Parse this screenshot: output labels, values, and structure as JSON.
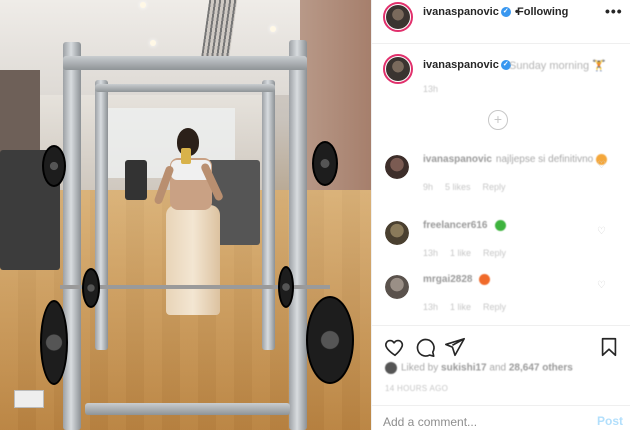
{
  "header": {
    "username": "ivanaspanovic",
    "separator": "•",
    "follow_status": "Following",
    "more_icon": "•••"
  },
  "caption": {
    "username": "ivanaspanovic",
    "text": "Sunday morning 🏋",
    "time": "13h",
    "load_more_icon": "+"
  },
  "comments": [
    {
      "username": "ivanaspanovic",
      "text": "najljepse si definitivno",
      "time": "9h",
      "likes": "5 likes",
      "reply": "Reply",
      "emoji_color": "#f4a73b"
    },
    {
      "username": "freelancer616",
      "text": "",
      "time": "13h",
      "likes": "1 like",
      "reply": "Reply",
      "emoji_color": "#3eb33e"
    },
    {
      "username": "mrgai2828",
      "text": "",
      "time": "13h",
      "likes": "1 like",
      "reply": "Reply",
      "emoji_color": "#f06a2a"
    }
  ],
  "actions": {
    "icons": [
      "heart-icon",
      "comment-icon",
      "share-icon",
      "bookmark-icon"
    ]
  },
  "likes": {
    "prefix": "Liked by",
    "first_user": "sukishi17",
    "middle": "and",
    "count": "28,647 others"
  },
  "time_ago": "14 HOURS AGO",
  "add_comment": {
    "placeholder": "Add a comment...",
    "post_label": "Post"
  },
  "colors": {
    "verified": "#3897f0",
    "story_ring": "#e1306c",
    "post_disabled": "#b2dffc"
  }
}
